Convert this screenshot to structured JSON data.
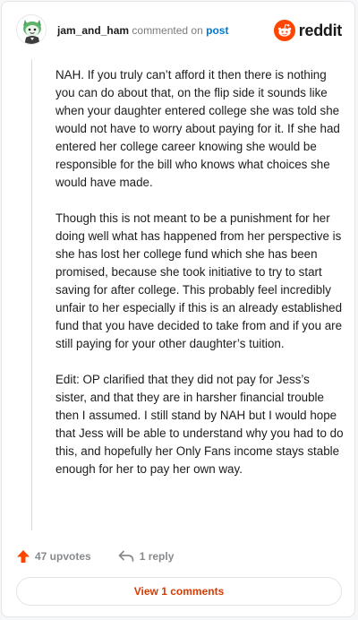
{
  "header": {
    "username": "jam_and_ham",
    "action_text": "commented on",
    "link_text": "post",
    "brand_name": "reddit",
    "avatar_icon": "snoo-avatar-icon",
    "brand_icon": "reddit-logo-icon"
  },
  "comment": {
    "paragraphs": [
      "NAH. If you truly can’t afford it then there is nothing you can do about that, on the flip side it sounds like when your daughter entered college she was told she would not have to worry about paying for it. If she had entered her college career knowing she would be responsible for the bill who knows what choices she would have made.",
      "Though this is not meant to be a punishment for her doing well what has happened from her perspective is she has lost her college fund which she has been promised, because she took initiative to try to start saving for after college. This probably feel incredibly unfair to her especially if this is an already established fund that you have decided to take from and if you are still paying for your other daughter’s tuition.",
      "Edit: OP clarified that they did not pay for Jess’s sister, and that they are in harsher financial trouble then I assumed. I still stand by NAH but I would hope that Jess will be able to understand why you had to do this, and hopefully her Only Fans income stays stable enough for her to pay her own way."
    ]
  },
  "actions": {
    "upvotes_label": "47 upvotes",
    "reply_label": "1 reply",
    "view_comments_label": "View 1 comments"
  },
  "colors": {
    "brand_orange": "#ff4500",
    "link_blue": "#0079d3",
    "view_button_text": "#d93a00"
  }
}
